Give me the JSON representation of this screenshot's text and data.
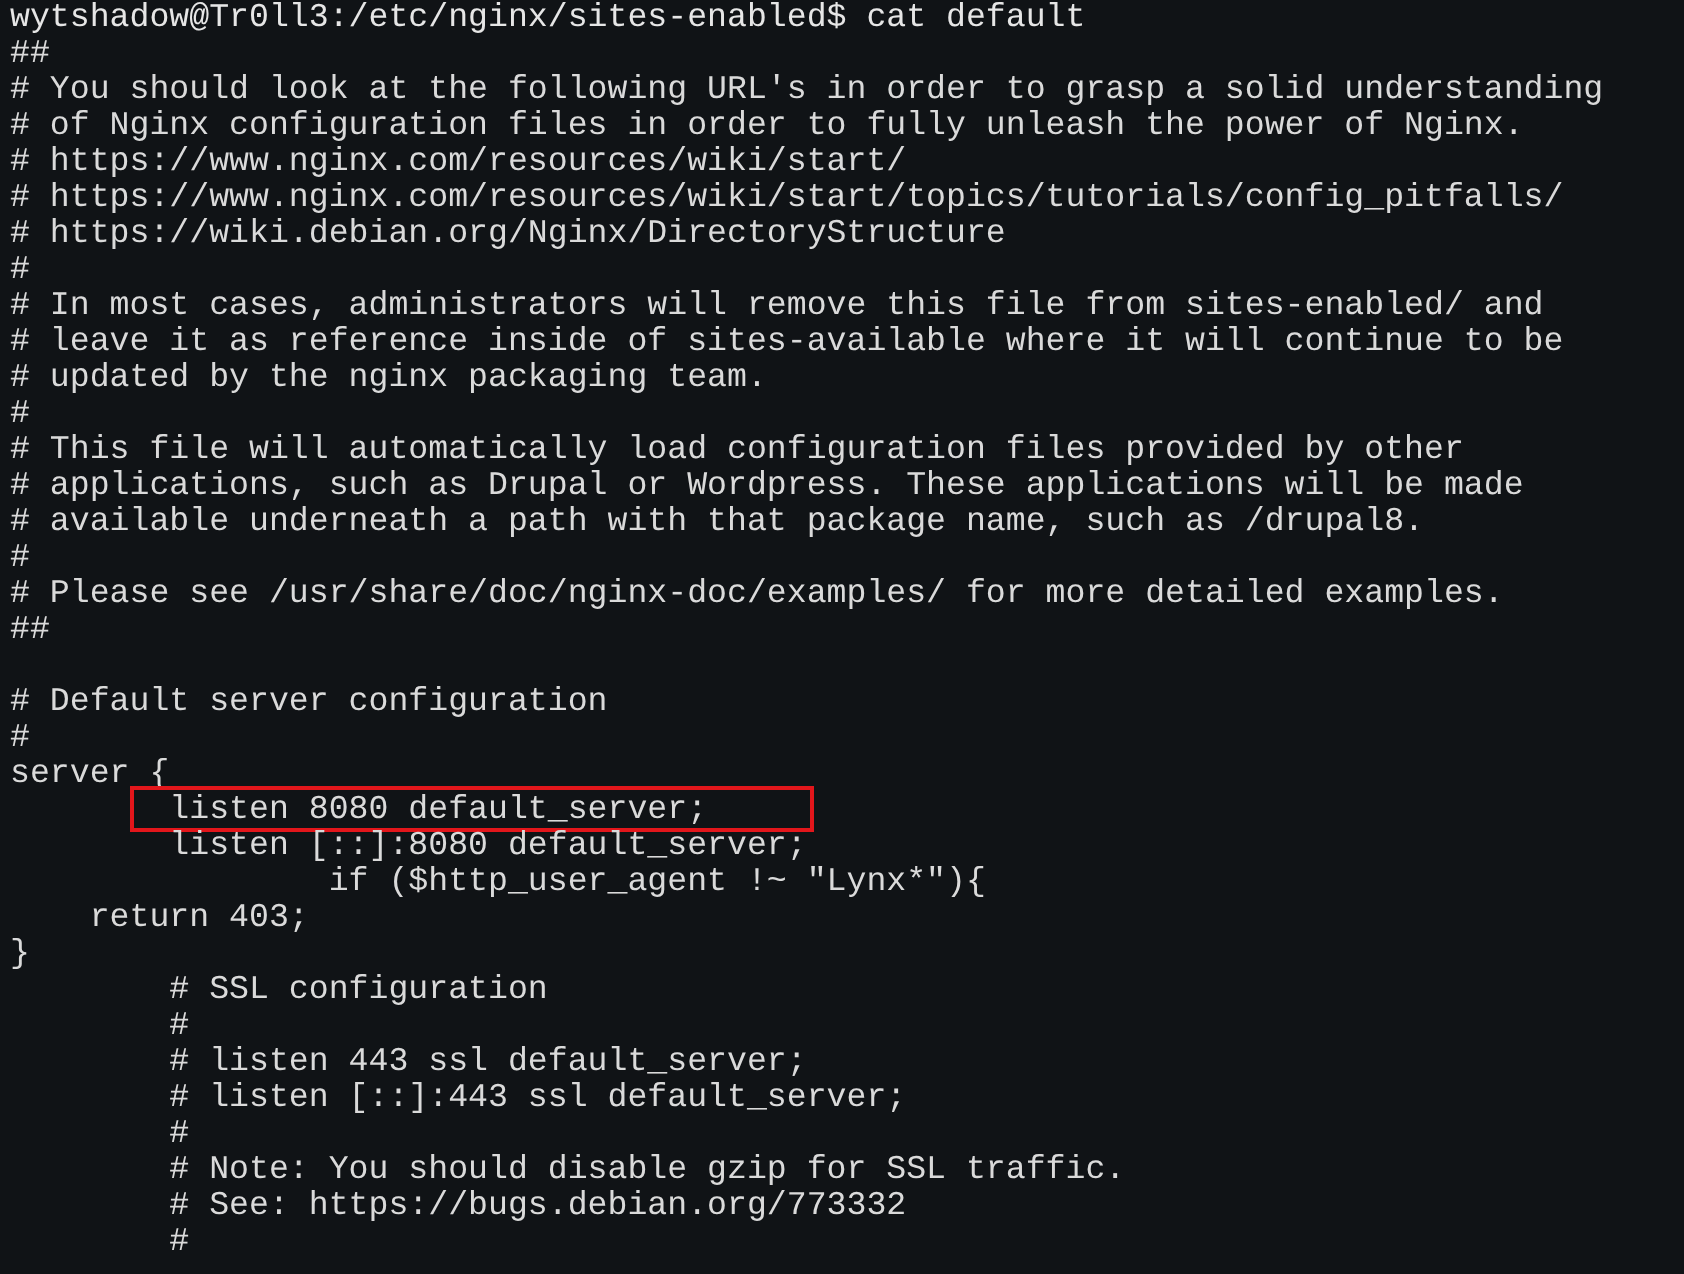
{
  "terminal": {
    "lines": [
      {
        "kind": "prompt",
        "text": "wytshadow@Tr0ll3:/etc/nginx/sites-enabled$ cat default",
        "highlighted": false
      },
      {
        "kind": "text",
        "text": "##",
        "highlighted": false
      },
      {
        "kind": "text",
        "text": "# You should look at the following URL's in order to grasp a solid understanding",
        "highlighted": false
      },
      {
        "kind": "text",
        "text": "# of Nginx configuration files in order to fully unleash the power of Nginx.",
        "highlighted": false
      },
      {
        "kind": "text",
        "text": "# https://www.nginx.com/resources/wiki/start/",
        "highlighted": false
      },
      {
        "kind": "text",
        "text": "# https://www.nginx.com/resources/wiki/start/topics/tutorials/config_pitfalls/",
        "highlighted": false
      },
      {
        "kind": "text",
        "text": "# https://wiki.debian.org/Nginx/DirectoryStructure",
        "highlighted": false
      },
      {
        "kind": "text",
        "text": "#",
        "highlighted": false
      },
      {
        "kind": "text",
        "text": "# In most cases, administrators will remove this file from sites-enabled/ and",
        "highlighted": false
      },
      {
        "kind": "text",
        "text": "# leave it as reference inside of sites-available where it will continue to be",
        "highlighted": false
      },
      {
        "kind": "text",
        "text": "# updated by the nginx packaging team.",
        "highlighted": false
      },
      {
        "kind": "text",
        "text": "#",
        "highlighted": false
      },
      {
        "kind": "text",
        "text": "# This file will automatically load configuration files provided by other",
        "highlighted": false
      },
      {
        "kind": "text",
        "text": "# applications, such as Drupal or Wordpress. These applications will be made",
        "highlighted": false
      },
      {
        "kind": "text",
        "text": "# available underneath a path with that package name, such as /drupal8.",
        "highlighted": false
      },
      {
        "kind": "text",
        "text": "#",
        "highlighted": false
      },
      {
        "kind": "text",
        "text": "# Please see /usr/share/doc/nginx-doc/examples/ for more detailed examples.",
        "highlighted": false
      },
      {
        "kind": "text",
        "text": "##",
        "highlighted": false
      },
      {
        "kind": "blank",
        "highlighted": false
      },
      {
        "kind": "text",
        "text": "# Default server configuration",
        "highlighted": false
      },
      {
        "kind": "text",
        "text": "#",
        "highlighted": false
      },
      {
        "kind": "text",
        "text": "server {",
        "highlighted": false
      },
      {
        "kind": "text",
        "text": "        listen 8080 default_server;",
        "highlighted": true
      },
      {
        "kind": "text",
        "text": "        listen [::]:8080 default_server;",
        "highlighted": false
      },
      {
        "kind": "text",
        "text": "                if ($http_user_agent !~ \"Lynx*\"){",
        "highlighted": false
      },
      {
        "kind": "text",
        "text": "    return 403;",
        "highlighted": false
      },
      {
        "kind": "text",
        "text": "}",
        "highlighted": false
      },
      {
        "kind": "text",
        "text": "        # SSL configuration",
        "highlighted": false
      },
      {
        "kind": "text",
        "text": "        #",
        "highlighted": false
      },
      {
        "kind": "text",
        "text": "        # listen 443 ssl default_server;",
        "highlighted": false
      },
      {
        "kind": "text",
        "text": "        # listen [::]:443 ssl default_server;",
        "highlighted": false
      },
      {
        "kind": "text",
        "text": "        #",
        "highlighted": false
      },
      {
        "kind": "text",
        "text": "        # Note: You should disable gzip for SSL traffic.",
        "highlighted": false
      },
      {
        "kind": "text",
        "text": "        # See: https://bugs.debian.org/773332",
        "highlighted": false
      },
      {
        "kind": "text",
        "text": "        #",
        "highlighted": false
      }
    ]
  }
}
